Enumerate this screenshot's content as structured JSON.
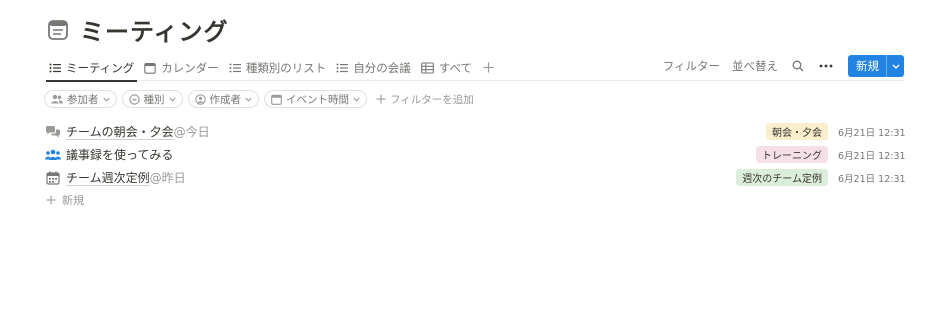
{
  "page": {
    "title": "ミーティング",
    "icon": "document-icon"
  },
  "tabs": [
    {
      "label": "ミーティング",
      "icon": "list-icon",
      "active": true
    },
    {
      "label": "カレンダー",
      "icon": "calendar-icon",
      "active": false
    },
    {
      "label": "種類別のリスト",
      "icon": "list-icon",
      "active": false
    },
    {
      "label": "自分の会議",
      "icon": "list-icon",
      "active": false
    },
    {
      "label": "すべて",
      "icon": "table-icon",
      "active": false
    }
  ],
  "toolbar": {
    "filter_label": "フィルター",
    "sort_label": "並べ替え",
    "new_label": "新規",
    "primary_color": "#2383e2"
  },
  "filters": [
    {
      "label": "参加者",
      "icon": "people-icon"
    },
    {
      "label": "種別",
      "icon": "select-icon"
    },
    {
      "label": "作成者",
      "icon": "person-icon"
    },
    {
      "label": "イベント時間",
      "icon": "calendar-icon"
    }
  ],
  "add_filter_label": "フィルターを追加",
  "rows": [
    {
      "title": "チームの朝会・夕会",
      "mention": "今日",
      "icon": "chat-icon",
      "tag": "朝会・夕会",
      "tag_color": "#fbeecc",
      "date": "6月21日 12:31"
    },
    {
      "title": "議事録を使ってみる",
      "mention": "",
      "icon": "people-icon",
      "tag": "トレーニング",
      "tag_color": "#f5e0e9",
      "date": "6月21日 12:31"
    },
    {
      "title": "チーム週次定例",
      "mention": "昨日",
      "icon": "calendar-icon",
      "tag": "週次のチーム定例",
      "tag_color": "#dbeddb",
      "date": "6月21日 12:31"
    }
  ],
  "new_row_label": "新規"
}
